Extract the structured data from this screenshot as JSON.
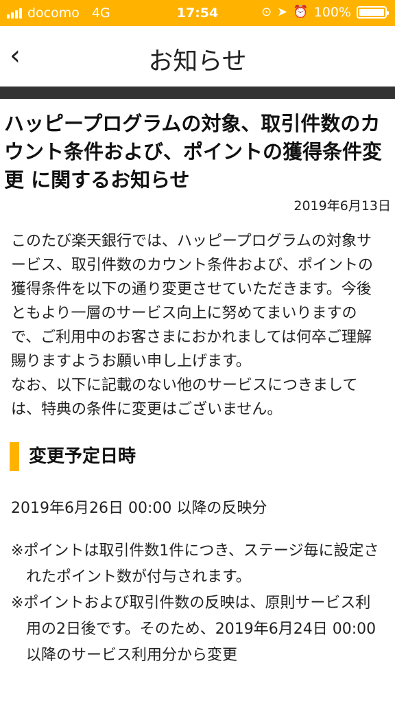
{
  "status_bar": {
    "carrier": "docomo",
    "network": "4G",
    "time": "17:54",
    "battery": "100%",
    "bg_color": "#ffb300"
  },
  "nav": {
    "back_icon": "chevron-left-icon",
    "back_glyph": "‹",
    "title": "お知らせ"
  },
  "article": {
    "title": "ハッピープログラムの対象、取引件数のカウント条件および、ポイントの獲得条件変更 に関するお知らせ",
    "date": "2019年6月13日",
    "body": "このたび楽天銀行では、ハッピープログラムの対象サービス、取引件数のカウント条件および、ポイントの獲得条件を以下の通り変更させていただきます。今後ともより一層のサービス向上に努めてまいりますので、ご利用中のお客さまにおかれましては何卒ご理解賜りますようお願い申し上げます。\nなお、以下に記載のない他のサービスにつきましては、特典の条件に変更はございません。",
    "section_heading": "変更予定日時",
    "apply_line": "2019年6月26日 00:00 以降の反映分",
    "notes": [
      "※ポイントは取引件数1件につき、ステージ毎に設定されたポイント数が付与されます。",
      "※ポイントおよび取引件数の反映は、原則サービス利用の2日後です。そのため、2019年6月24日 00:00以降のサービス利用分から変更"
    ],
    "accent_color": "#ffb300"
  }
}
